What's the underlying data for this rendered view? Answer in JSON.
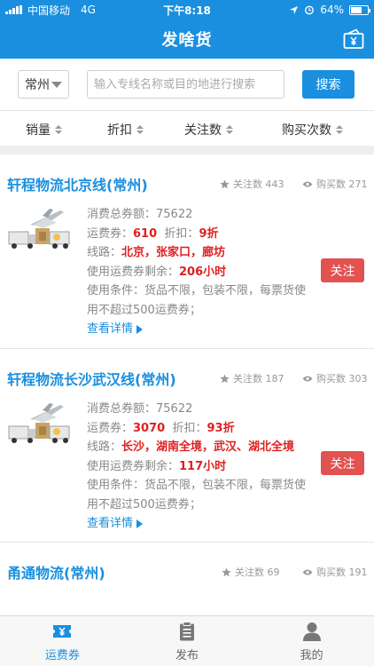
{
  "status_bar": {
    "carrier": "中国移动",
    "network": "4G",
    "time": "下午8:18",
    "battery": "64%",
    "battery_level": 0.64
  },
  "nav": {
    "title": "发啥货",
    "right_icon": "wallet-yen-icon"
  },
  "search": {
    "city": "常州",
    "placeholder": "输入专线名称或目的地进行搜索",
    "button": "搜索"
  },
  "sort": {
    "items": [
      "销量",
      "折扣",
      "关注数",
      "购买次数"
    ]
  },
  "listings": [
    {
      "title": "轩程物流北京线(常州)",
      "follows": "关注数 443",
      "purchases": "购买数 271",
      "total_label": "消费总券额：",
      "total": "75622",
      "coupon_label": "运费券：",
      "coupon": "610",
      "discount_label": "折扣：",
      "discount": "9折",
      "route_label": "线路：",
      "route": "北京，张家口，廊坊",
      "remain_label": "使用运费券剩余：",
      "remain": "206小时",
      "condition": "使用条件：货品不限，包装不限，每票货使用不超过500运费券；",
      "detail": "查看详情",
      "follow_button": "关注"
    },
    {
      "title": "轩程物流长沙武汉线(常州)",
      "follows": "关注数 187",
      "purchases": "购买数 303",
      "total_label": "消费总券额：",
      "total": "75622",
      "coupon_label": "运费券：",
      "coupon": "3070",
      "discount_label": "折扣：",
      "discount": "93折",
      "route_label": "线路：",
      "route": "长沙，湖南全境，武汉、湖北全境",
      "remain_label": "使用运费券剩余：",
      "remain": "117小时",
      "condition": "使用条件：货品不限，包装不限，每票货使用不超过500运费券；",
      "detail": "查看详情",
      "follow_button": "关注"
    },
    {
      "title": "甬通物流(常州)",
      "follows": "关注数 69",
      "purchases": "购买数 191"
    }
  ],
  "tabs": [
    {
      "label": "运费券",
      "icon": "coupon-yen-icon",
      "active": true
    },
    {
      "label": "发布",
      "icon": "clipboard-icon",
      "active": false
    },
    {
      "label": "我的",
      "icon": "user-icon",
      "active": false
    }
  ],
  "colors": {
    "primary": "#1a8fdf",
    "accent_red": "#e02020",
    "follow_button": "#e25250"
  }
}
